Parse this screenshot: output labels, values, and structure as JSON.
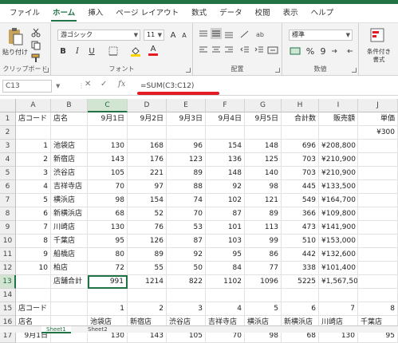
{
  "tabs": [
    "ファイル",
    "ホーム",
    "挿入",
    "ページ レイアウト",
    "数式",
    "データ",
    "校閲",
    "表示",
    "ヘルプ"
  ],
  "ribbon": {
    "groups": {
      "clipboard": "クリップボード",
      "font": "フォント",
      "alignment": "配置",
      "number": "数値",
      "styles_label": "条件付き",
      "styles_label2": "書式"
    },
    "paste_label": "貼り付け",
    "font_name": "游ゴシック",
    "font_size": "11",
    "number_format": "標準",
    "bold": "B",
    "italic": "I",
    "underline": "U",
    "font_color_glyph": "A",
    "grow_font": "A",
    "percent": "%",
    "comma": "9",
    "wrap_label": "ab",
    "accent": "#217346"
  },
  "formula_bar": {
    "name_box": "C13",
    "cancel": "✕",
    "enter": "✓",
    "fx": "fx",
    "formula": "=SUM(C3:C12)"
  },
  "columns": [
    "A",
    "B",
    "C",
    "D",
    "E",
    "F",
    "G",
    "H",
    "I",
    "J"
  ],
  "selected_col": "C",
  "rows": [
    {
      "n": "1",
      "cells": [
        "店コード",
        "店名",
        "9月1日",
        "9月2日",
        "9月3日",
        "9月4日",
        "9月5日",
        "合計数",
        "販売額",
        "単価"
      ]
    },
    {
      "n": "2",
      "cells": [
        "",
        "",
        "",
        "",
        "",
        "",
        "",
        "",
        "",
        "¥300"
      ]
    },
    {
      "n": "3",
      "cells": [
        "1",
        "池袋店",
        "130",
        "168",
        "96",
        "154",
        "148",
        "696",
        "¥208,800",
        ""
      ]
    },
    {
      "n": "4",
      "cells": [
        "2",
        "新宿店",
        "143",
        "176",
        "123",
        "136",
        "125",
        "703",
        "¥210,900",
        ""
      ]
    },
    {
      "n": "5",
      "cells": [
        "3",
        "渋谷店",
        "105",
        "221",
        "89",
        "148",
        "140",
        "703",
        "¥210,900",
        ""
      ]
    },
    {
      "n": "6",
      "cells": [
        "4",
        "吉祥寺店",
        "70",
        "97",
        "88",
        "92",
        "98",
        "445",
        "¥133,500",
        ""
      ]
    },
    {
      "n": "7",
      "cells": [
        "5",
        "横浜店",
        "98",
        "154",
        "74",
        "102",
        "121",
        "549",
        "¥164,700",
        ""
      ]
    },
    {
      "n": "8",
      "cells": [
        "6",
        "新横浜店",
        "68",
        "52",
        "70",
        "87",
        "89",
        "366",
        "¥109,800",
        ""
      ]
    },
    {
      "n": "9",
      "cells": [
        "7",
        "川崎店",
        "130",
        "76",
        "53",
        "101",
        "113",
        "473",
        "¥141,900",
        ""
      ]
    },
    {
      "n": "10",
      "cells": [
        "8",
        "千葉店",
        "95",
        "126",
        "87",
        "103",
        "99",
        "510",
        "¥153,000",
        ""
      ]
    },
    {
      "n": "11",
      "cells": [
        "9",
        "船橋店",
        "80",
        "89",
        "92",
        "95",
        "86",
        "442",
        "¥132,600",
        ""
      ]
    },
    {
      "n": "12",
      "cells": [
        "10",
        "柏店",
        "72",
        "55",
        "50",
        "84",
        "77",
        "338",
        "¥101,400",
        ""
      ]
    },
    {
      "n": "13",
      "cells": [
        "",
        "店舗合計",
        "991",
        "1214",
        "822",
        "1102",
        "1096",
        "5225",
        "¥1,567,500",
        ""
      ]
    },
    {
      "n": "14",
      "cells": [
        "",
        "",
        "",
        "",
        "",
        "",
        "",
        "",
        "",
        ""
      ]
    },
    {
      "n": "15",
      "cells": [
        "店コード",
        "",
        "1",
        "2",
        "3",
        "4",
        "5",
        "6",
        "7",
        "8"
      ]
    },
    {
      "n": "16",
      "cells": [
        "店名",
        "",
        "池袋店",
        "新宿店",
        "渋谷店",
        "吉祥寺店",
        "横浜店",
        "新横浜店",
        "川崎店",
        "千葉店"
      ]
    },
    {
      "n": "17",
      "cells": [
        "9月1日",
        "",
        "130",
        "143",
        "105",
        "70",
        "98",
        "68",
        "130",
        "95"
      ]
    }
  ],
  "sheets": [
    "Sheet1",
    "Sheet2"
  ]
}
